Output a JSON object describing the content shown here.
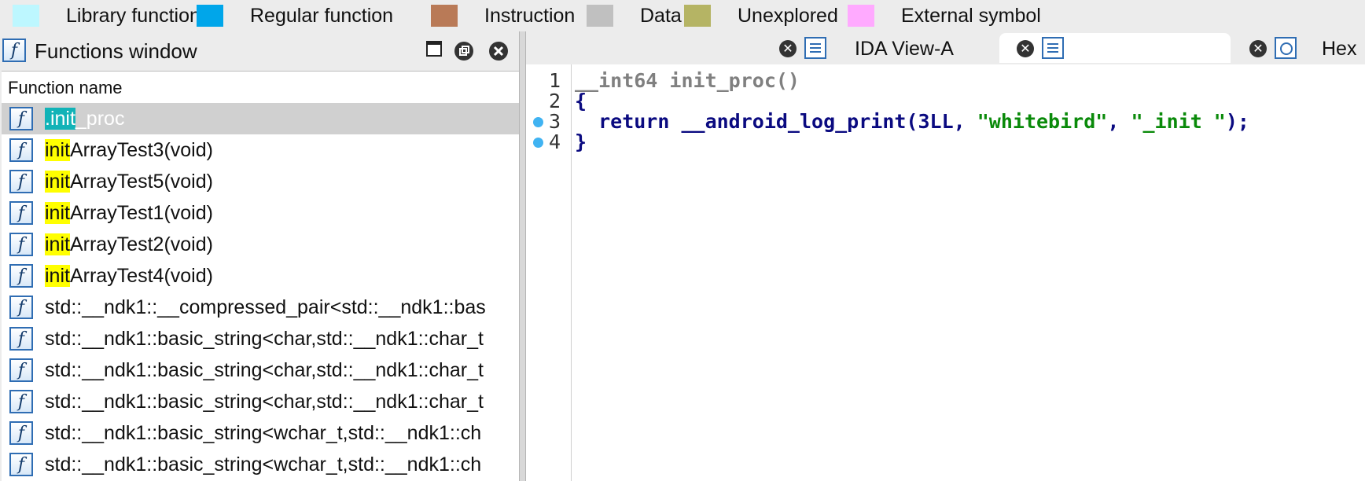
{
  "legend": [
    {
      "label": "Library function",
      "color": "#bdf7ff"
    },
    {
      "label": "Regular function",
      "color": "#00a6ea"
    },
    {
      "label": "Instruction",
      "color": "#b97a57"
    },
    {
      "label": "Data",
      "color": "#c0c0c0"
    },
    {
      "label": "Unexplored",
      "color": "#b5b464"
    },
    {
      "label": "External symbol",
      "color": "#ffaaff"
    }
  ],
  "functions_window": {
    "title": "Functions window",
    "icon": "function-icon",
    "column_header": "Function name",
    "rows": [
      {
        "highlight": ".init",
        "rest": "_proc",
        "selected": true
      },
      {
        "highlight": "init",
        "rest": "ArrayTest3(void)"
      },
      {
        "highlight": "init",
        "rest": "ArrayTest5(void)"
      },
      {
        "highlight": "init",
        "rest": "ArrayTest1(void)"
      },
      {
        "highlight": "init",
        "rest": "ArrayTest2(void)"
      },
      {
        "highlight": "init",
        "rest": "ArrayTest4(void)"
      },
      {
        "highlight": "",
        "rest": "std::__ndk1::__compressed_pair<std::__ndk1::bas"
      },
      {
        "highlight": "",
        "rest": "std::__ndk1::basic_string<char,std::__ndk1::char_t"
      },
      {
        "highlight": "",
        "rest": "std::__ndk1::basic_string<char,std::__ndk1::char_t"
      },
      {
        "highlight": "",
        "rest": "std::__ndk1::basic_string<char,std::__ndk1::char_t"
      },
      {
        "highlight": "",
        "rest": "std::__ndk1::basic_string<wchar_t,std::__ndk1::ch"
      },
      {
        "highlight": "",
        "rest": "std::__ndk1::basic_string<wchar_t,std::__ndk1::ch"
      }
    ]
  },
  "tabs": [
    {
      "label": "IDA View-A",
      "active": false,
      "icon": "text-view-icon"
    },
    {
      "label": "",
      "active": true,
      "icon": "text-view-icon"
    },
    {
      "label": "Hex",
      "active": false,
      "icon": "hex-view-icon"
    }
  ],
  "code": {
    "lines": [
      {
        "no": "1",
        "breakpoint": false,
        "tokens": [
          [
            "gray",
            "__int64 init_proc()"
          ]
        ]
      },
      {
        "no": "2",
        "breakpoint": false,
        "tokens": [
          [
            "navy",
            "{"
          ]
        ]
      },
      {
        "no": "3",
        "breakpoint": true,
        "tokens": [
          [
            "navy",
            "  return __android_log_print(3LL, "
          ],
          [
            "str",
            "\"whitebird\""
          ],
          [
            "navy",
            ", "
          ],
          [
            "str",
            "\"_init \""
          ],
          [
            "navy",
            ");"
          ]
        ]
      },
      {
        "no": "4",
        "breakpoint": true,
        "tokens": [
          [
            "navy",
            "}"
          ]
        ]
      }
    ]
  }
}
